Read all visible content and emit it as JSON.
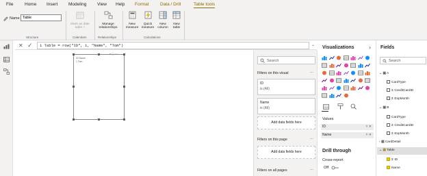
{
  "ribbon": {
    "tabs": [
      "File",
      "Home",
      "Insert",
      "Modeling",
      "View",
      "Help",
      "Format",
      "Data / Drill",
      "Table tools"
    ],
    "name_label": "Name",
    "name_value": "Table",
    "groups": {
      "structure": "Structure",
      "calendars": "Calendars",
      "relationships": "Relationships",
      "calculations": "Calculations"
    },
    "buttons": {
      "mark_date_1": "Mark as date",
      "mark_date_2": "table ˅",
      "manage_1": "Manage",
      "manage_2": "relationships",
      "new_measure_1": "New",
      "new_measure_2": "measure",
      "quick_measure_1": "Quick",
      "quick_measure_2": "measure",
      "new_column_1": "New",
      "new_column_2": "column",
      "new_table_1": "New",
      "new_table_2": "table"
    }
  },
  "formula": {
    "text": "1  Table = row(\"ID\", 1, \"Name\", \"Tom\")"
  },
  "visual": {
    "header": "ID  Name",
    "row": "1  Tom"
  },
  "filters": {
    "search_placeholder": "Search",
    "on_visual": "Filters on this visual",
    "card_id_title": "ID",
    "card_id_value": "is (All)",
    "card_name_title": "Name",
    "card_name_value": "is (All)",
    "add_fields": "Add data fields here",
    "on_page": "Filters on this page",
    "on_all_pages": "Filters on all pages",
    "dots": "..."
  },
  "visualizations": {
    "title": "Visualizations",
    "values_label": "Values",
    "wells": [
      "ID",
      "Name"
    ],
    "drill_title": "Drill through",
    "cross_report": "Cross-report",
    "toggle_off": "Off",
    "chevron": "›"
  },
  "fields": {
    "title": "Fields",
    "search_placeholder": "Search",
    "tables": [
      {
        "name": "A",
        "fields": [
          "CardType",
          "CreditCardID",
          "ExpMonth"
        ]
      },
      {
        "name": "B",
        "fields": [
          "CardType",
          "CreditCardID",
          "ExpMonth"
        ]
      },
      {
        "name": "CardDetail",
        "fields": []
      },
      {
        "name": "Table",
        "fields": [
          "ID",
          "Name"
        ]
      }
    ]
  },
  "colors": {
    "accent": "#8f6b00",
    "pbi_yellow": "#f2c811",
    "selected_bg": "#e1dfdd"
  }
}
